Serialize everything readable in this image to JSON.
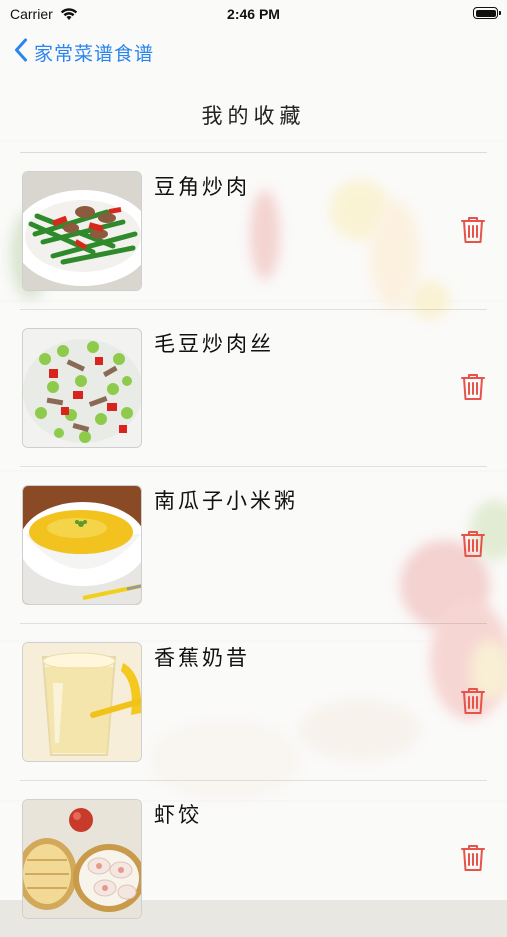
{
  "status_bar": {
    "carrier": "Carrier",
    "time": "2:46 PM"
  },
  "nav": {
    "back_label": "家常菜谱食谱"
  },
  "page": {
    "title": "我的收藏"
  },
  "favorites": [
    {
      "name": "豆角炒肉",
      "image": "green-beans-stir-fried-pork"
    },
    {
      "name": "毛豆炒肉丝",
      "image": "edamame-shredded-pork"
    },
    {
      "name": "南瓜子小米粥",
      "image": "pumpkin-millet-porridge"
    },
    {
      "name": "香蕉奶昔",
      "image": "banana-milkshake"
    },
    {
      "name": "虾饺",
      "image": "shrimp-dumplings"
    }
  ],
  "colors": {
    "accent": "#2c84ee",
    "delete": "#e5534b"
  },
  "icons": {
    "back": "chevron-left-icon",
    "delete": "trash-icon"
  }
}
